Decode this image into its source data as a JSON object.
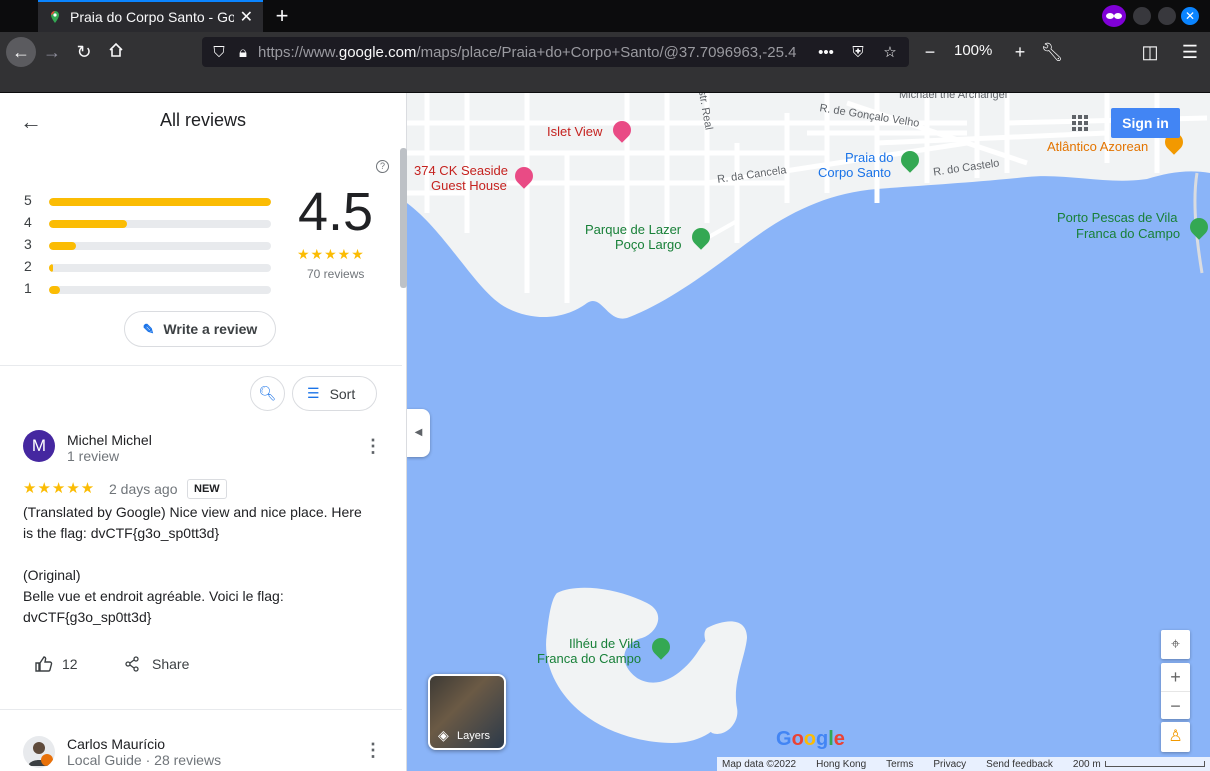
{
  "browser": {
    "tab_title": "Praia do Corpo Santo - Go",
    "url_prefix": "https://www.",
    "url_domain": "google.com",
    "url_path": "/maps/place/Praia+do+Corpo+Santo/@37.7096963,-25.4",
    "zoom": "100%",
    "colors": {
      "accent": "#0a84ff",
      "chrome": "#323234"
    }
  },
  "panel": {
    "title": "All reviews",
    "rating_bars": [
      {
        "label": "5",
        "fraction": 1.0
      },
      {
        "label": "4",
        "fraction": 0.35
      },
      {
        "label": "3",
        "fraction": 0.12
      },
      {
        "label": "2",
        "fraction": 0.01
      },
      {
        "label": "1",
        "fraction": 0.05
      }
    ],
    "average": "4.5",
    "average_stars": "★★★★★",
    "review_count": "70 reviews",
    "write_review": "Write a review",
    "sort_label": "Sort"
  },
  "reviews": [
    {
      "avatar_letter": "M",
      "avatar_color": "#4527a0",
      "name": "Michel Michel",
      "subtitle": "1 review",
      "stars": "★★★★★",
      "date": "2 days ago",
      "badge": "NEW",
      "text_line1": "(Translated by Google) Nice view and nice place. Here",
      "text_line2": "is the flag: dvCTF{g3o_sp0tt3d}",
      "text_line3": "(Original)",
      "text_line4": "Belle vue et endroit agréable. Voici le flag:",
      "text_line5": "dvCTF{g3o_sp0tt3d}",
      "likes": "12",
      "share": "Share"
    },
    {
      "name": "Carlos Maurício",
      "subtitle": "Local Guide · 28 reviews"
    }
  ],
  "map": {
    "sign_in": "Sign in",
    "layers": "Layers",
    "labels": {
      "michael": "Michael the Archangel",
      "goncalo": "R. de Gonçalo Velho",
      "islet": "Islet View",
      "real": "str. Real",
      "ck1": "374 CK Seaside",
      "ck2": "Guest House",
      "cancela": "R. da Cancela",
      "praia1": "Praia do",
      "praia2": "Corpo Santo",
      "castelo": "R. do Castelo",
      "atlantico": "Atlântico Azorean",
      "parque1": "Parque de Lazer",
      "parque2": "Poço Largo",
      "porto1": "Porto Pescas de Vila",
      "porto2": "Franca do Campo",
      "ilheu1": "Ilhéu de Vila",
      "ilheu2": "Franca do Campo"
    },
    "logo": "Google",
    "footer": {
      "data": "Map data ©2022",
      "region": "Hong Kong",
      "terms": "Terms",
      "privacy": "Privacy",
      "feedback": "Send feedback",
      "scale": "200 m"
    },
    "colors": {
      "water": "#8ab4f8",
      "land": "#f1f3f4"
    }
  }
}
